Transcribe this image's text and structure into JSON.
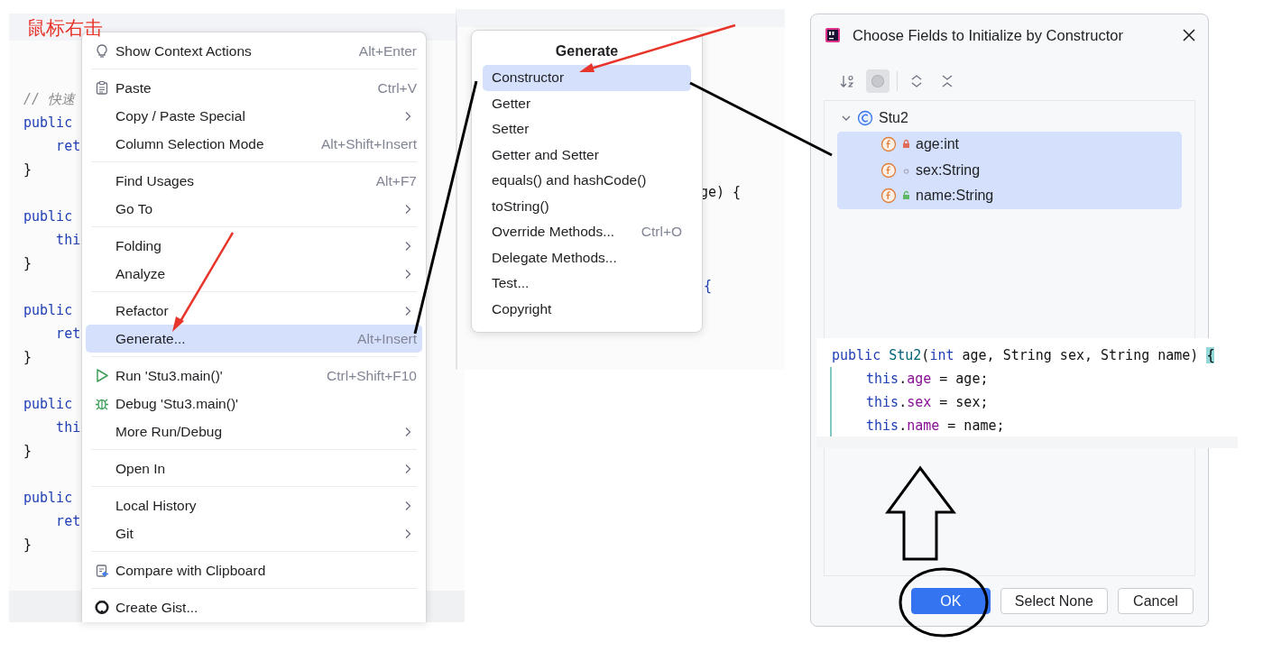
{
  "caption": "鼠标右击",
  "left_editor": {
    "blocks": [
      [
        {
          "text": "// 快速",
          "kind": "comment"
        },
        {
          "text": "public",
          "kind": "keyword"
        },
        {
          "text": "    ret",
          "kind": "keyword"
        },
        {
          "text": "}",
          "kind": "plain"
        }
      ],
      [
        {
          "text": "public",
          "kind": "keyword"
        },
        {
          "text": "    thi",
          "kind": "keyword"
        },
        {
          "text": "}",
          "kind": "plain"
        }
      ],
      [
        {
          "text": "public",
          "kind": "keyword"
        },
        {
          "text": "    ret",
          "kind": "keyword"
        },
        {
          "text": "}",
          "kind": "plain"
        }
      ],
      [
        {
          "text": "public",
          "kind": "keyword"
        },
        {
          "text": "    thi",
          "kind": "keyword"
        },
        {
          "text": "}",
          "kind": "plain"
        }
      ],
      [
        {
          "text": "public",
          "kind": "keyword"
        },
        {
          "text": "    ret",
          "kind": "keyword"
        },
        {
          "text": "}",
          "kind": "plain"
        }
      ]
    ]
  },
  "context_menu": {
    "groups": [
      {
        "items": [
          {
            "label": "Show Context Actions",
            "shortcut": "Alt+Enter",
            "submenu": false,
            "selected": false
          }
        ]
      },
      {
        "items": [
          {
            "label": "Paste",
            "shortcut": "Ctrl+V",
            "submenu": false,
            "selected": false
          },
          {
            "label": "Copy / Paste Special",
            "submenu": true,
            "selected": false
          },
          {
            "label": "Column Selection Mode",
            "shortcut": "Alt+Shift+Insert",
            "submenu": false,
            "selected": false
          }
        ]
      },
      {
        "items": [
          {
            "label": "Find Usages",
            "shortcut": "Alt+F7",
            "submenu": false,
            "selected": false
          },
          {
            "label": "Go To",
            "submenu": true,
            "selected": false
          }
        ]
      },
      {
        "items": [
          {
            "label": "Folding",
            "submenu": true,
            "selected": false
          },
          {
            "label": "Analyze",
            "submenu": true,
            "selected": false
          }
        ]
      },
      {
        "items": [
          {
            "label": "Refactor",
            "submenu": true,
            "selected": false
          },
          {
            "label": "Generate...",
            "shortcut": "Alt+Insert",
            "submenu": false,
            "selected": true
          }
        ]
      },
      {
        "items": [
          {
            "label": "Run 'Stu3.main()'",
            "shortcut": "Ctrl+Shift+F10",
            "submenu": false,
            "selected": false
          },
          {
            "label": "Debug 'Stu3.main()'",
            "submenu": false,
            "selected": false
          },
          {
            "label": "More Run/Debug",
            "submenu": true,
            "selected": false
          }
        ]
      },
      {
        "items": [
          {
            "label": "Open In",
            "submenu": true,
            "selected": false
          }
        ]
      },
      {
        "items": [
          {
            "label": "Local History",
            "submenu": true,
            "selected": false
          },
          {
            "label": "Git",
            "submenu": true,
            "selected": false
          }
        ]
      },
      {
        "items": [
          {
            "label": "Compare with Clipboard",
            "submenu": false,
            "selected": false
          }
        ]
      },
      {
        "items": [
          {
            "label": "Create Gist...",
            "submenu": false,
            "selected": false
          }
        ]
      }
    ]
  },
  "middle_editor": {
    "fragments": [
      {
        "text": "ge) {",
        "kind": "plain"
      },
      {
        "text": "{",
        "kind": "keyword"
      }
    ]
  },
  "generate_menu": {
    "title": "Generate",
    "items": [
      {
        "label": "Constructor",
        "selected": true
      },
      {
        "label": "Getter",
        "selected": false
      },
      {
        "label": "Setter",
        "selected": false
      },
      {
        "label": "Getter and Setter",
        "selected": false
      },
      {
        "label": "equals() and hashCode()",
        "selected": false
      },
      {
        "label": "toString()",
        "selected": false
      },
      {
        "label": "Override Methods...",
        "shortcut": "Ctrl+O",
        "selected": false
      },
      {
        "label": "Delegate Methods...",
        "selected": false
      },
      {
        "label": "Test...",
        "selected": false
      },
      {
        "label": "Copyright",
        "selected": false
      }
    ]
  },
  "dialog": {
    "title": "Choose Fields to Initialize by Constructor",
    "toolbar": [
      {
        "on": false
      },
      {
        "on": true
      },
      {
        "on": false
      },
      {
        "on": false
      }
    ],
    "tree": {
      "label": "Stu2",
      "expanded": true,
      "children": [
        {
          "label": "age:int",
          "kind": "private",
          "selected": true
        },
        {
          "label": "sex:String",
          "kind": "package",
          "selected": true
        },
        {
          "label": "name:String",
          "kind": "public",
          "selected": true
        }
      ]
    },
    "buttons": [
      {
        "label": "OK",
        "kind": "primary"
      },
      {
        "label": "Select None",
        "kind": "secondary"
      },
      {
        "label": "Cancel",
        "kind": "secondary"
      }
    ]
  },
  "code_preview": {
    "lines": [
      [
        {
          "text": "public ",
          "kind": "keyword"
        },
        {
          "text": "Stu2",
          "kind": "name"
        },
        {
          "text": "(",
          "kind": "plain"
        },
        {
          "text": "int",
          "kind": "keyword"
        },
        {
          "text": " age, String sex, String name) ",
          "kind": "plain"
        },
        {
          "text": "{",
          "kind": "brace"
        }
      ],
      [
        {
          "text": "this",
          "kind": "keyword"
        },
        {
          "text": ".",
          "kind": "plain"
        },
        {
          "text": "age",
          "kind": "field"
        },
        {
          "text": " = age;",
          "kind": "plain"
        }
      ],
      [
        {
          "text": "this",
          "kind": "keyword"
        },
        {
          "text": ".",
          "kind": "plain"
        },
        {
          "text": "sex",
          "kind": "field"
        },
        {
          "text": " = sex;",
          "kind": "plain"
        }
      ],
      [
        {
          "text": "this",
          "kind": "keyword"
        },
        {
          "text": ".",
          "kind": "plain"
        },
        {
          "text": "name",
          "kind": "field"
        },
        {
          "text": " = name;",
          "kind": "plain"
        }
      ]
    ]
  }
}
